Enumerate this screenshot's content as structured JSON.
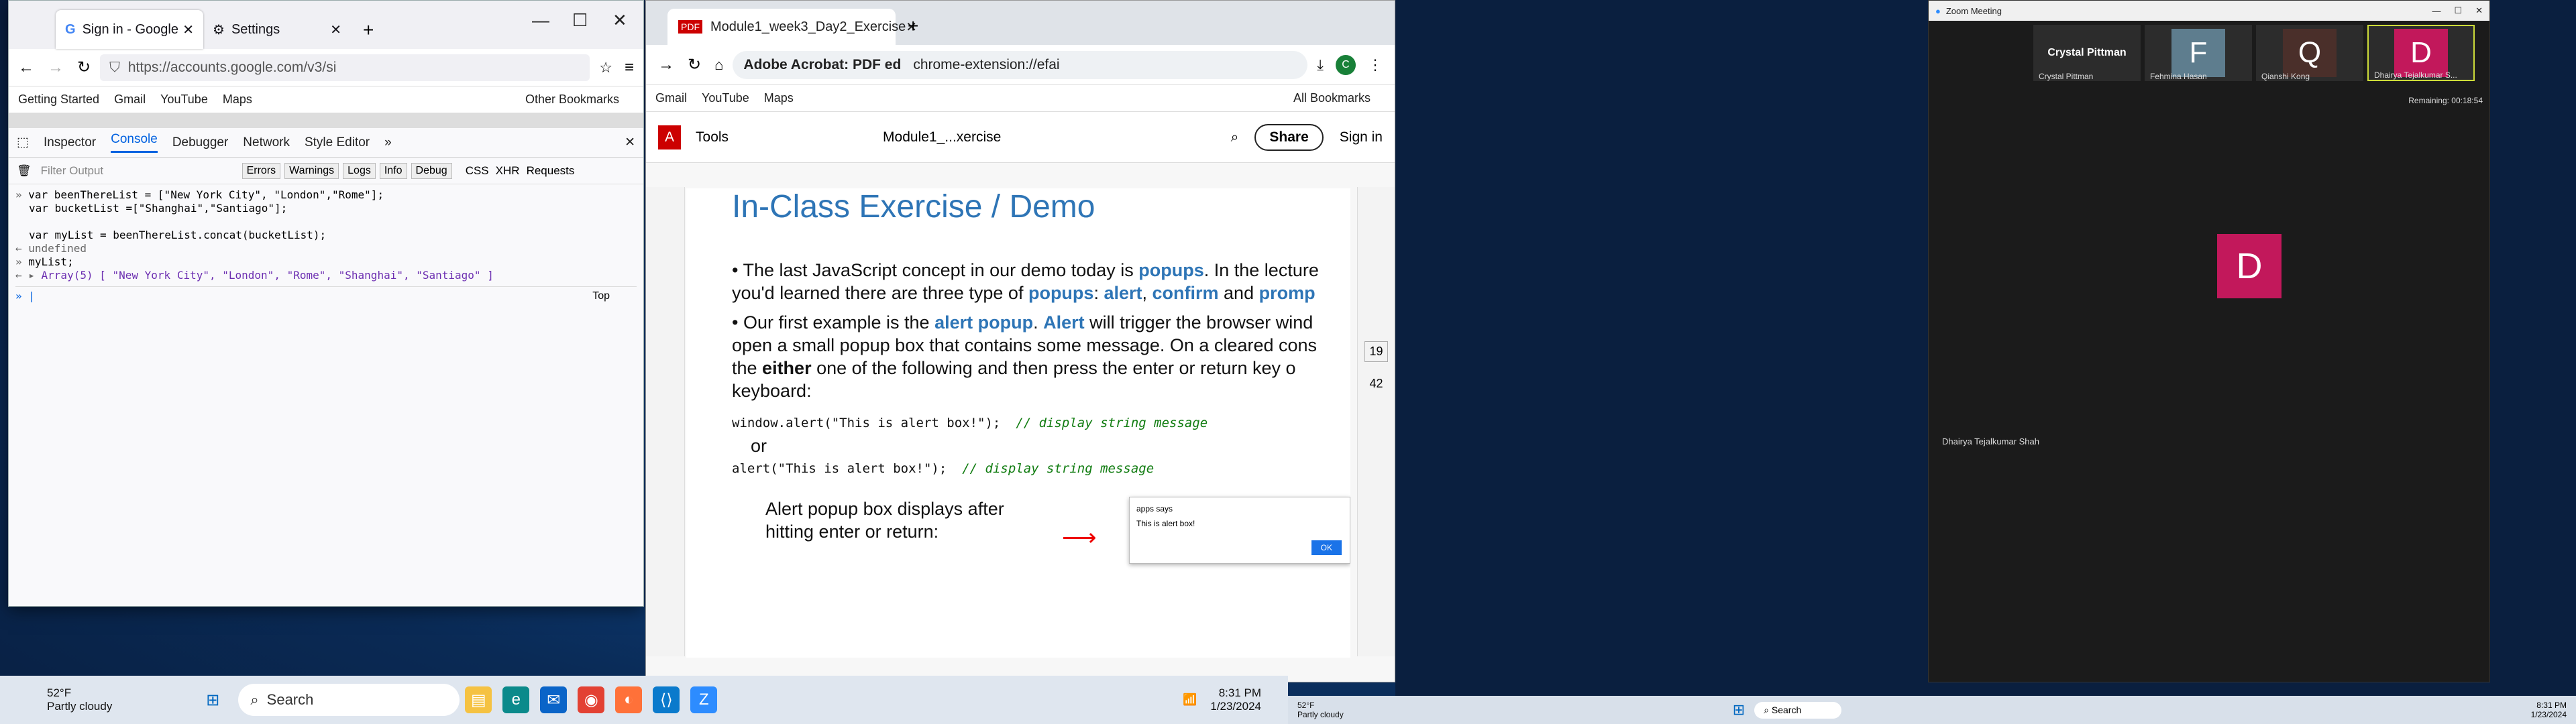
{
  "firefox": {
    "tabs": [
      "Sign in - Google",
      "Settings"
    ],
    "url": "https://accounts.google.com/v3/si",
    "bookmarks": [
      "Getting Started",
      "Gmail",
      "YouTube",
      "Maps"
    ],
    "other_bookmarks": "Other Bookmarks",
    "devtools_tabs": [
      "Inspector",
      "Console",
      "Debugger",
      "Network",
      "Style Editor"
    ],
    "filter_placeholder": "Filter Output",
    "filter_buttons": [
      "Errors",
      "Warnings",
      "Logs",
      "Info",
      "Debug"
    ],
    "filter_extra": [
      "CSS",
      "XHR",
      "Requests"
    ],
    "console_lines": [
      "var beenThereList = [\"New York City\", \"London\",\"Rome\"];",
      "var bucketList =[\"Shanghai\",\"Santiago\"];",
      "",
      "var myList = beenThereList.concat(bucketList);",
      "undefined",
      "myList;",
      "Array(5) [ \"New York City\", \"London\", \"Rome\", \"Shanghai\", \"Santiago\" ]"
    ],
    "context": "Top"
  },
  "chrome": {
    "tab": "Module1_week3_Day2_Exercise",
    "omnibox_badge": "Adobe Acrobat: PDF ed",
    "omnibox_url": "chrome-extension://efai",
    "profile": "C",
    "bookmarks": [
      "Gmail",
      "YouTube",
      "Maps"
    ],
    "all_bookmarks": "All Bookmarks"
  },
  "acrobat": {
    "tools": "Tools",
    "file": "Module1_...xercise",
    "share": "Share",
    "signin": "Sign in",
    "page": "19",
    "pages": "42"
  },
  "slide": {
    "title": "In-Class Exercise / Demo",
    "b1a": "The last JavaScript concept in our demo today is ",
    "b1b": "popups",
    "b1c": ". In the lecture you'd learned there are three type of ",
    "b1d": "popups",
    "b1e": ": ",
    "b1f": "alert",
    "b1g": ", ",
    "b1h": "confirm",
    "b1i": " and ",
    "b1j": "promp",
    "b2a": "Our first example is the ",
    "b2b": "alert popup",
    "b2c": ". ",
    "b2d": "Alert",
    "b2e": " will trigger the browser wind open a small popup box that contains some message. On a cleared cons the ",
    "b2f": "either",
    "b2g": " one of the following and then press the enter or return key o keyboard:",
    "code1": "window.alert(\"This is alert box!\");",
    "cmt1": "// display string message",
    "or": "or",
    "code2": "alert(\"This is alert box!\");",
    "cmt2": "// display string message",
    "caption": "Alert popup box displays after hitting enter or return:",
    "popup_title": "apps says",
    "popup_msg": "This is alert box!",
    "popup_ok": "OK"
  },
  "zoom": {
    "title": "Zoom Meeting",
    "remaining": "Remaining: 00:18:54",
    "participants": [
      {
        "name": "Crystal Pittman",
        "initial": "",
        "color": "#2c2c2c"
      },
      {
        "name": "Fehmina Hasan",
        "initial": "F",
        "color": "#5e7d8e"
      },
      {
        "name": "Qianshi Kong",
        "initial": "Q",
        "color": "#4a2f2a"
      },
      {
        "name": "Dhairya Tejalkumar S...",
        "initial": "D",
        "color": "#c2185b"
      }
    ],
    "active_initial": "D",
    "active_name": "Dhairya Tejalkumar Shah"
  },
  "taskbar": {
    "weather_temp": "52°F",
    "weather_desc": "Partly cloudy",
    "search": "Search",
    "time": "8:31 PM",
    "date": "1/23/2024"
  }
}
